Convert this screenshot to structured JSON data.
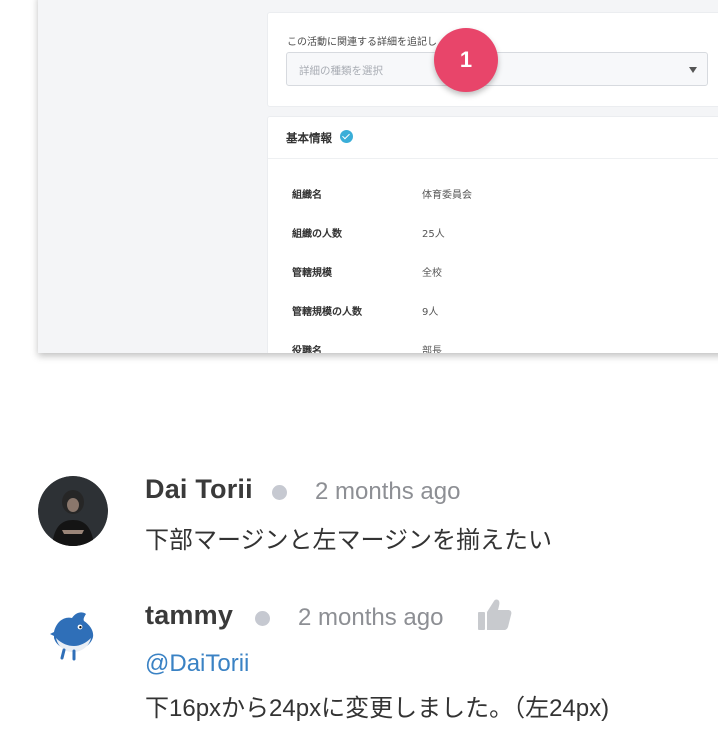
{
  "screenshot": {
    "detail_hint": "この活動に関連する詳細を追記し",
    "detail_select_placeholder": "詳細の種類を選択",
    "basic_info_title": "基本情報",
    "badge_number": "1",
    "info_rows": [
      {
        "label": "組織名",
        "value": "体育委員会"
      },
      {
        "label": "組織の人数",
        "value": "25人"
      },
      {
        "label": "管轄規模",
        "value": "全校"
      },
      {
        "label": "管轄規模の人数",
        "value": "9人"
      },
      {
        "label": "役職名",
        "value": "部長"
      }
    ]
  },
  "comments": [
    {
      "author": "Dai Torii",
      "time": "2 months ago",
      "text": "下部マージンと左マージンを揃えたい"
    },
    {
      "author": "tammy",
      "time": "2 months ago",
      "mention": "@DaiTorii",
      "text": "下16pxから24pxに変更しました。（左24px)",
      "like_icon": "thumbs-up-icon"
    }
  ],
  "colors": {
    "badge": "#e8456a",
    "mention": "#3a82c4",
    "check": "#3aaed8",
    "presence_dot": "#c6c9d1"
  }
}
